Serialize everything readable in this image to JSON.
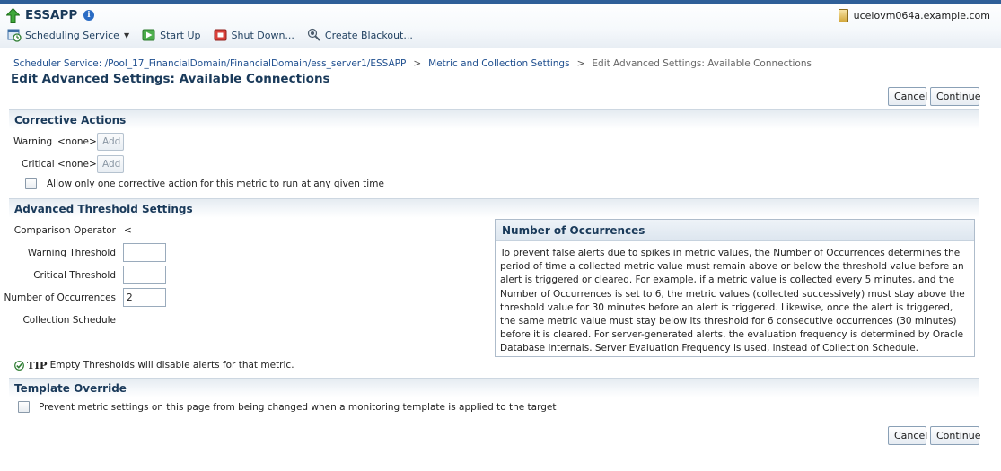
{
  "header": {
    "app_name": "ESSAPP",
    "host_name": "ucelovm064a.example.com"
  },
  "toolbar": {
    "scheduling_service": "Scheduling Service",
    "start_up": "Start Up",
    "shut_down": "Shut Down...",
    "create_blackout": "Create Blackout..."
  },
  "breadcrumb": {
    "item1": "Scheduler Service: /Pool_17_FinancialDomain/FinancialDomain/ess_server1/ESSAPP",
    "item2": "Metric and Collection Settings",
    "current": "Edit Advanced Settings: Available Connections",
    "separator": ">"
  },
  "page_title": "Edit Advanced Settings: Available Connections",
  "buttons": {
    "cancel": "Cancel",
    "continue": "Continue",
    "add": "Add"
  },
  "corrective_actions": {
    "title": "Corrective Actions",
    "warning_label": "Warning",
    "warning_value": "<none>",
    "critical_label": "Critical",
    "critical_value": "<none>",
    "allow_one_label": "Allow only one corrective action for this metric to run at any given time"
  },
  "advanced_threshold": {
    "title": "Advanced Threshold Settings",
    "comparison_operator_label": "Comparison Operator",
    "comparison_operator_value": "<",
    "warning_threshold_label": "Warning Threshold",
    "warning_threshold_value": "",
    "critical_threshold_label": "Critical Threshold",
    "critical_threshold_value": "",
    "occurrences_label": "Number of Occurrences",
    "occurrences_value": "2",
    "collection_schedule_label": "Collection Schedule"
  },
  "occurrences_box": {
    "title": "Number of Occurrences",
    "body": "To prevent false alerts due to spikes in metric values, the Number of Occurrences determines the period of time a collected metric value must remain above or below the threshold value before an alert is triggered or cleared. For example, if a metric value is collected every 5 minutes, and the Number of Occurrences is set to 6, the metric values (collected successively) must stay above the threshold value for 30 minutes before an alert is triggered. Likewise, once the alert is triggered, the same metric value must stay below its threshold for 6 consecutive occurrences (30 minutes) before it is cleared. For server-generated alerts, the evaluation frequency is determined by Oracle Database internals. Server Evaluation Frequency is used, instead of Collection Schedule."
  },
  "tip": {
    "label": "TIP",
    "text": "Empty Thresholds will disable alerts for that metric."
  },
  "template_override": {
    "title": "Template Override",
    "prevent_label": "Prevent metric settings on this page from being changed when a monitoring template is applied to the target"
  }
}
